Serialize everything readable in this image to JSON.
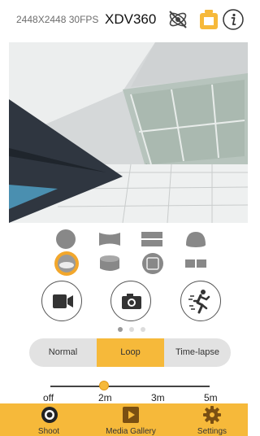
{
  "header": {
    "resolution_fps": "2448X2448 30FPS",
    "camera_model": "XDV360"
  },
  "icons": {
    "sync": "no-sync-icon",
    "battery": "battery-icon",
    "info": "info-icon"
  },
  "preview": {
    "description_icon": "live-camera-preview"
  },
  "view_modes": {
    "row1": [
      "sphere-view-icon",
      "panorama-view-icon",
      "dual-panorama-view-icon",
      "dome-view-icon"
    ],
    "row2": [
      "fisheye-view-icon",
      "cylinder-view-icon",
      "cube-view-icon",
      "split-view-icon"
    ],
    "selected": "fisheye-view-icon"
  },
  "actions": {
    "video": "video-camera-icon",
    "photo": "photo-camera-icon",
    "burst": "burst-mode-icon"
  },
  "pager": {
    "total": 3,
    "active_index": 0
  },
  "modes": {
    "options": [
      "Normal",
      "Loop",
      "Time-lapse"
    ],
    "selected": "Loop"
  },
  "loop_slider": {
    "labels": [
      "off",
      "2m",
      "3m",
      "5m"
    ],
    "value": "2m"
  },
  "tabs": {
    "shoot": "Shoot",
    "media_gallery": "Media Gallery",
    "settings": "Settings",
    "active": "Shoot"
  },
  "colors": {
    "accent": "#f6b93a",
    "selected_ring": "#f2a72c",
    "icon_gray": "#888888"
  }
}
